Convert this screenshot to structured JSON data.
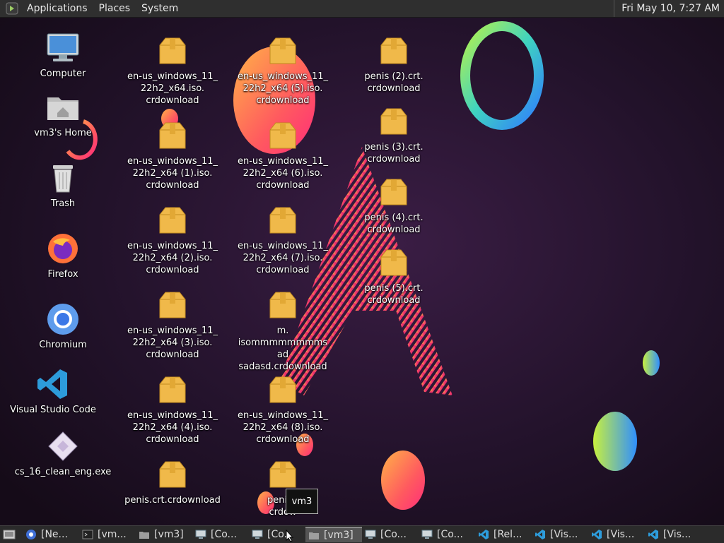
{
  "top_panel": {
    "menus": [
      "Applications",
      "Places",
      "System"
    ],
    "clock": "Fri May 10,  7:27 AM"
  },
  "desktop_icons": {
    "computer": "Computer",
    "home": "vm3's Home",
    "trash": "Trash",
    "firefox": "Firefox",
    "chromium": "Chromium",
    "vscode": "Visual Studio Code",
    "cs16": "cs_16_clean_eng.exe",
    "files": [
      "en-us_windows_11_\n22h2_x64.iso.\ncrdownload",
      "en-us_windows_11_\n22h2_x64 (5).iso.\ncrdownload",
      "penis (2).crt.\ncrdownload",
      "en-us_windows_11_\n22h2_x64 (1).iso.\ncrdownload",
      "en-us_windows_11_\n22h2_x64 (6).iso.\ncrdownload",
      "penis (3).crt.\ncrdownload",
      "en-us_windows_11_\n22h2_x64 (2).iso.\ncrdownload",
      "en-us_windows_11_\n22h2_x64 (7).iso.\ncrdownload",
      "penis (4).crt.\ncrdownload",
      "en-us_windows_11_\n22h2_x64 (3).iso.\ncrdownload",
      "m.\nisommmmmmmmsad\nsadasd.crdownload",
      "penis (5).crt.\ncrdownload",
      "en-us_windows_11_\n22h2_x64 (4).iso.\ncrdownload",
      "en-us_windows_11_\n22h2_x64 (8).iso.\ncrdownload",
      "penis.crt.crdownload",
      "penis (\ncrdow"
    ]
  },
  "tooltip": "vm3",
  "taskbar": {
    "tasks": [
      {
        "label": "[Ne...",
        "icon": "firefox-icon"
      },
      {
        "label": "[vm...",
        "icon": "terminal-icon"
      },
      {
        "label": "[vm3]",
        "icon": "folder-icon"
      },
      {
        "label": "[Co...",
        "icon": "monitor-icon"
      },
      {
        "label": "[Co...",
        "icon": "monitor-icon"
      },
      {
        "label": "[vm3]",
        "icon": "folder-icon"
      },
      {
        "label": "[Co...",
        "icon": "monitor-icon"
      },
      {
        "label": "[Co...",
        "icon": "monitor-icon"
      },
      {
        "label": "[Rel...",
        "icon": "vscode-icon"
      },
      {
        "label": "[Vis...",
        "icon": "vscode-icon"
      },
      {
        "label": "[Vis...",
        "icon": "vscode-icon"
      },
      {
        "label": "[Vis...",
        "icon": "vscode-icon"
      }
    ],
    "active_index": 5
  },
  "colors": {
    "panel": "#2f2f2f",
    "folder": "#f0b94a",
    "accent_pink": "#e0306f"
  }
}
